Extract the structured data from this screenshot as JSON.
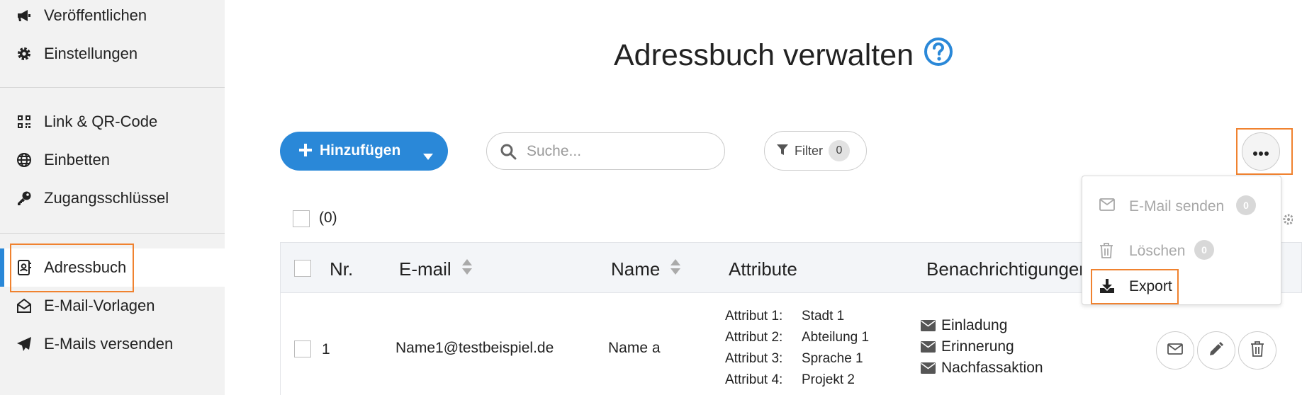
{
  "sidebar": {
    "items": [
      {
        "label": "Veröffentlichen",
        "icon": "megaphone-icon"
      },
      {
        "label": "Einstellungen",
        "icon": "gear-icon"
      },
      {
        "label": "Link & QR-Code",
        "icon": "qr-code-icon"
      },
      {
        "label": "Einbetten",
        "icon": "globe-icon"
      },
      {
        "label": "Zugangsschlüssel",
        "icon": "key-icon"
      },
      {
        "label": "Adressbuch",
        "icon": "address-book-icon",
        "active": true
      },
      {
        "label": "E-Mail-Vorlagen",
        "icon": "envelope-open-icon"
      },
      {
        "label": "E-Mails versenden",
        "icon": "paper-plane-icon"
      }
    ]
  },
  "header": {
    "title": "Adressbuch verwalten",
    "help_icon": "question-circle-icon"
  },
  "toolbar": {
    "add_label": "Hinzufügen",
    "search_placeholder": "Suche...",
    "filter_label": "Filter",
    "filter_count": "0",
    "more_icon": "ellipsis-icon"
  },
  "selection": {
    "count_label": "(0)"
  },
  "table": {
    "columns": [
      "Nr.",
      "E-mail",
      "Name",
      "Attribute",
      "Benachrichtigungen"
    ],
    "rows": [
      {
        "nr": "1",
        "email": "Name1@testbeispiel.de",
        "name": "Name a",
        "attributes": [
          {
            "key": "Attribut 1:",
            "value": "Stadt 1"
          },
          {
            "key": "Attribut 2:",
            "value": "Abteilung 1"
          },
          {
            "key": "Attribut 3:",
            "value": "Sprache 1"
          },
          {
            "key": "Attribut 4:",
            "value": "Projekt 2"
          }
        ],
        "notifications": [
          "Einladung",
          "Erinnerung",
          "Nachfassaktion"
        ]
      }
    ]
  },
  "dropdown": {
    "items": [
      {
        "label": "E-Mail senden",
        "count": "0",
        "disabled": true,
        "icon": "envelope-icon"
      },
      {
        "label": "Löschen",
        "count": "0",
        "disabled": true,
        "icon": "trash-icon"
      },
      {
        "label": "Export",
        "disabled": false,
        "icon": "download-icon"
      }
    ]
  },
  "colors": {
    "accent": "#2a88d8",
    "highlight": "#f0822f",
    "sidebar_bg": "#f2f2f2"
  }
}
